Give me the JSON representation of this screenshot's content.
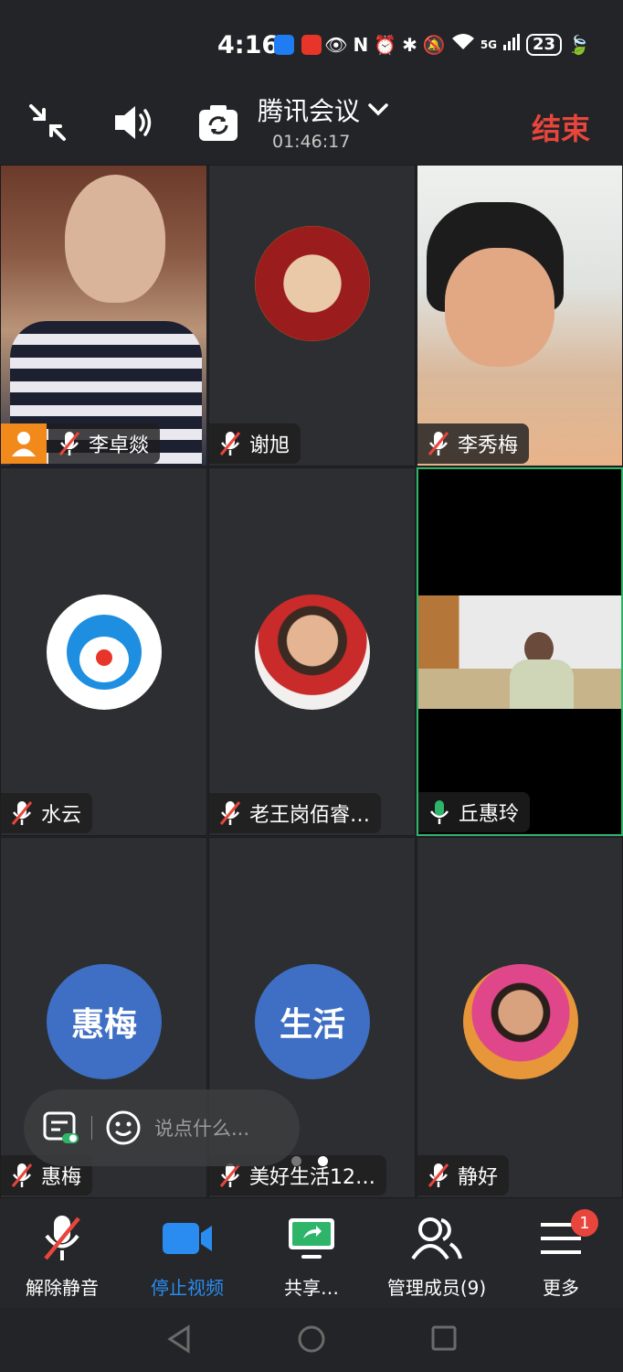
{
  "status_bar": {
    "time": "4:16",
    "network": "5G",
    "battery": "23"
  },
  "top_bar": {
    "title": "腾讯会议",
    "timer": "01:46:17",
    "end_label": "结束"
  },
  "participants": [
    {
      "name": "李卓燚",
      "muted": true,
      "host": true
    },
    {
      "name": "谢旭",
      "muted": true
    },
    {
      "name": "李秀梅",
      "muted": true
    },
    {
      "name": "水云",
      "muted": true
    },
    {
      "name": "老王岗佰睿…",
      "muted": true
    },
    {
      "name": "丘惠玲",
      "muted": false,
      "active": true
    },
    {
      "name": "惠梅",
      "muted": true,
      "avatar_text": "惠梅"
    },
    {
      "name": "美好生活12…",
      "muted": true,
      "avatar_text": "生活"
    },
    {
      "name": "静好",
      "muted": true
    }
  ],
  "chat": {
    "placeholder": "说点什么..."
  },
  "toolbar": {
    "unmute": "解除静音",
    "stop_video": "停止视频",
    "share": "共享…",
    "manage": "管理成员(9)",
    "more": "更多",
    "more_badge": "1"
  },
  "colors": {
    "accent_blue": "#2a8cf0",
    "end_red": "#e8453c",
    "active_green": "#2fb56a",
    "avatar_blue": "#3e6fc4"
  }
}
